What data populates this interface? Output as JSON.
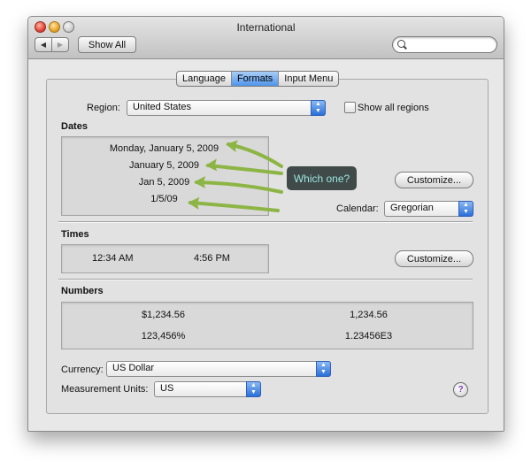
{
  "window": {
    "title": "International",
    "toolbar": {
      "back": "◀",
      "forward": "▶",
      "show_all": "Show All",
      "search_placeholder": ""
    }
  },
  "tabs": [
    {
      "label": "Language",
      "selected": false
    },
    {
      "label": "Formats",
      "selected": true
    },
    {
      "label": "Input Menu",
      "selected": false
    }
  ],
  "region": {
    "label": "Region:",
    "value": "United States",
    "show_all_label": "Show all regions",
    "show_all_checked": false
  },
  "dates": {
    "heading": "Dates",
    "samples": [
      "Monday, January 5, 2009",
      "January 5, 2009",
      "Jan 5, 2009",
      "1/5/09"
    ],
    "customize": "Customize...",
    "calendar_label": "Calendar:",
    "calendar_value": "Gregorian"
  },
  "annotation": {
    "text": "Which one?",
    "color": "#8db545"
  },
  "times": {
    "heading": "Times",
    "samples": [
      "12:34 AM",
      "4:56 PM"
    ],
    "customize": "Customize..."
  },
  "numbers": {
    "heading": "Numbers",
    "samples": [
      "$1,234.56",
      "1,234.56",
      "123,456%",
      "1.23456E3"
    ]
  },
  "currency": {
    "label": "Currency:",
    "value": "US Dollar"
  },
  "measurement": {
    "label": "Measurement Units:",
    "value": "US"
  },
  "help": "?"
}
